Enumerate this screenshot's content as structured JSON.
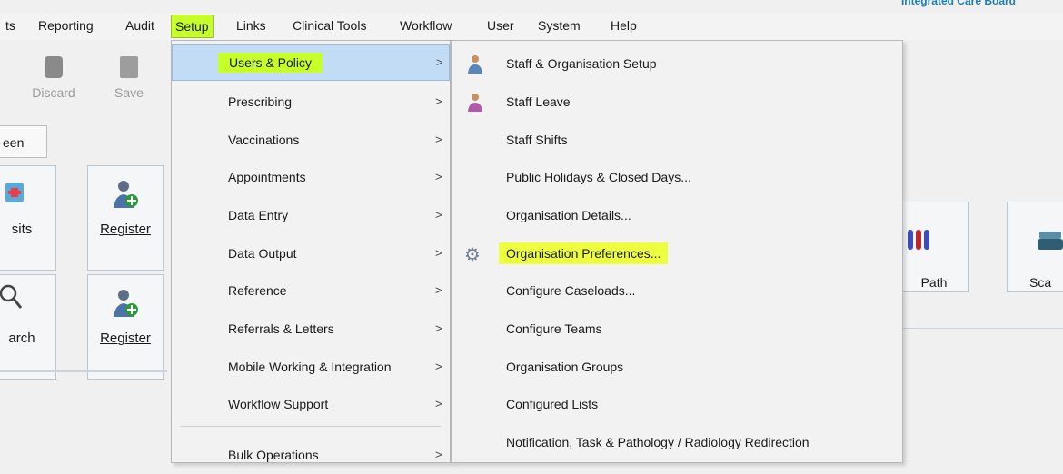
{
  "brand": {
    "text": "Integrated Care Board"
  },
  "menubar": {
    "items": [
      "ts",
      "Reporting",
      "Audit",
      "Setup",
      "Links",
      "Clinical Tools",
      "Workflow",
      "User",
      "System",
      "Help"
    ]
  },
  "toolbar": {
    "discard_label": "Discard",
    "save_label": "Save"
  },
  "screen_button": {
    "label": "een"
  },
  "tiles": {
    "visits": {
      "label": "sits"
    },
    "register1": {
      "label": "Register"
    },
    "search": {
      "label": "arch"
    },
    "register2": {
      "label": "Register"
    },
    "path": {
      "label": "Path"
    },
    "scan": {
      "label": "Sca"
    }
  },
  "setup_menu": {
    "items": [
      {
        "label": "Users & Policy"
      },
      {
        "label": "Prescribing"
      },
      {
        "label": "Vaccinations"
      },
      {
        "label": "Appointments"
      },
      {
        "label": "Data Entry"
      },
      {
        "label": "Data Output"
      },
      {
        "label": "Reference"
      },
      {
        "label": "Referrals & Letters"
      },
      {
        "label": "Mobile Working & Integration"
      },
      {
        "label": "Workflow Support"
      },
      {
        "label": "Bulk Operations"
      }
    ],
    "arrow": ">"
  },
  "users_policy_menu": {
    "items": [
      {
        "label": "Staff & Organisation Setup"
      },
      {
        "label": "Staff Leave"
      },
      {
        "label": "Staff Shifts"
      },
      {
        "label": "Public Holidays & Closed Days..."
      },
      {
        "label": "Organisation Details..."
      },
      {
        "label": "Organisation Preferences..."
      },
      {
        "label": "Configure Caseloads..."
      },
      {
        "label": "Configure Teams"
      },
      {
        "label": "Organisation Groups"
      },
      {
        "label": "Configured Lists"
      },
      {
        "label": "Notification, Task & Pathology / Radiology Redirection"
      }
    ]
  },
  "colors": {
    "highlight": "#c7ff2a",
    "menu_selection": "#c2dcf5",
    "brand": "#1b7fb5"
  },
  "icons": [
    "staff-icon",
    "staff-leave-icon",
    "gear-icon",
    "register-icon",
    "search-icon",
    "path-icon",
    "scan-icon",
    "discard-icon",
    "save-icon"
  ]
}
